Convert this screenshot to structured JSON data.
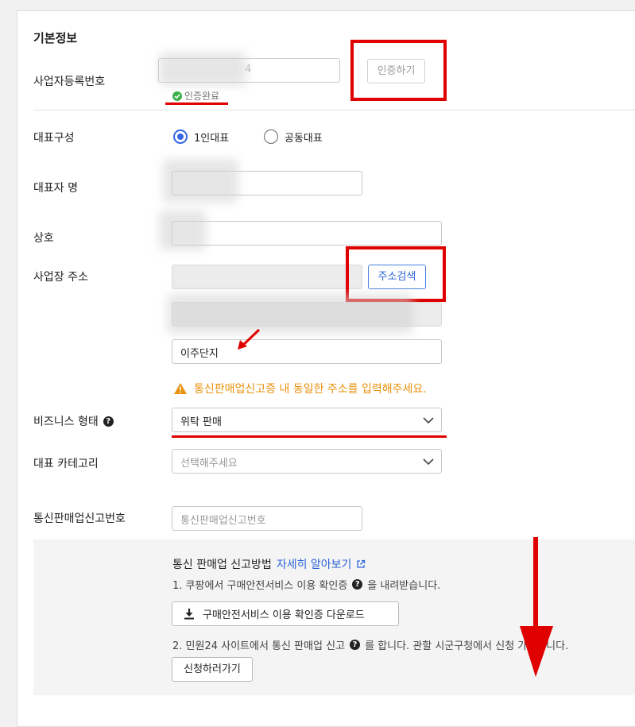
{
  "section_title": "기본정보",
  "business_reg": {
    "label": "사업자등록번호",
    "value_suffix": "4",
    "verify_button": "인증하기",
    "status": "인증완료"
  },
  "rep_type": {
    "label": "대표구성",
    "options": [
      "1인대표",
      "공동대표"
    ],
    "selected": "1인대표"
  },
  "rep_name": {
    "label": "대표자 명"
  },
  "company": {
    "label": "상호"
  },
  "address": {
    "label": "사업장 주소",
    "search_button": "주소검색",
    "detail_value": "이주단지",
    "warning": "통신판매업신고증 내 동일한 주소를 입력해주세요."
  },
  "business_type": {
    "label": "비즈니스 형태",
    "value": "위탁 판매"
  },
  "category": {
    "label": "대표 카테고리",
    "placeholder": "선택해주세요"
  },
  "ecommerce_no": {
    "label": "통신판매업신고번호",
    "placeholder": "통신판매업신고번호"
  },
  "guide": {
    "title": "통신 판매업 신고방법",
    "learn_more": "자세히 알아보기",
    "step1_prefix": "1. 쿠팡에서 구매안전서비스 이용 확인증",
    "step1_suffix": "을 내려받습니다.",
    "download_button": "구매안전서비스 이용 확인증 다운로드",
    "step2_prefix": "2. 민원24 사이트에서 통신 판매업 신고",
    "step2_suffix": "를 합니다. 관할 시군구청에서 신청 가능합니다.",
    "apply_button": "신청하러가기"
  },
  "colors": {
    "accent_blue": "#2b63d9",
    "warning_orange": "#e8910c",
    "annotation_red": "#e00000",
    "success_green": "#3cb04a"
  }
}
